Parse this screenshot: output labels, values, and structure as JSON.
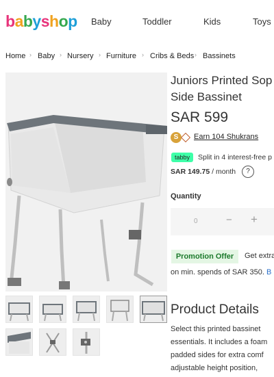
{
  "logo": {
    "letters": [
      "b",
      "a",
      "b",
      "y",
      "s",
      "h",
      "o",
      "p"
    ],
    "colors": [
      "#e8347b",
      "#f0a21f",
      "#35a84f",
      "#1e9fd8",
      "#e8347b",
      "#f0a21f",
      "#35a84f",
      "#1e9fd8"
    ]
  },
  "nav": {
    "items": [
      "Baby",
      "Toddler",
      "Kids",
      "Toys"
    ]
  },
  "breadcrumb": {
    "items": [
      "Home",
      "Baby",
      "Nursery",
      "Furniture",
      "Cribs & Beds",
      "Bassinets"
    ]
  },
  "product": {
    "title_line1": "Juniors Printed Sop",
    "title_line2": "Side Bassinet",
    "price": "SAR 599"
  },
  "shukrans": {
    "icon_letter": "S",
    "text": "Earn 104 Shukrans"
  },
  "tabby": {
    "badge": "tabby",
    "text": "Split in 4 interest-free p",
    "amount": "SAR 149.75",
    "per": " / month",
    "help": "?"
  },
  "quantity": {
    "label": "Quantity",
    "value": "0",
    "minus": "−",
    "plus": "+"
  },
  "promo": {
    "badge": "Promotion Offer",
    "text": "Get extra",
    "sub_prefix": "on min. spends of SAR 350.",
    "sub_link": "B"
  },
  "details": {
    "title": "Product Details",
    "lines": [
      "Select this printed bassinet",
      "essentials. It includes a foam",
      "padded sides for extra comf",
      "adjustable height position,"
    ]
  },
  "colors": {
    "accent_green": "#1c7a2c",
    "tabby_green": "#3effa8",
    "link_blue": "#2a6fc9"
  }
}
